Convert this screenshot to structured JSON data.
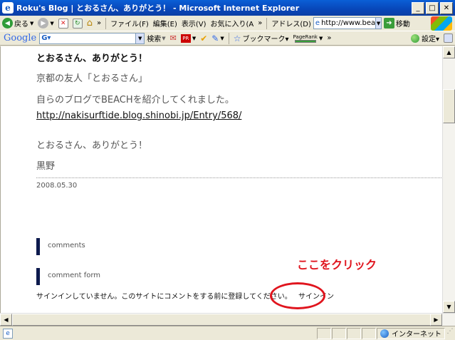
{
  "window": {
    "title": "Roku's Blog | とおるさん、ありがとう！ - Microsoft Internet Explorer",
    "icon": "ie-icon",
    "controls": [
      "minimize-icon",
      "maximize-icon",
      "close-icon"
    ]
  },
  "toolbar1": {
    "back_label": "戻る",
    "menu": [
      "ファイル(F)",
      "編集(E)",
      "表示(V)",
      "お気に入り(A"
    ],
    "more": "»",
    "address_label": "アドレス(D)",
    "address_value": "http://www.bea",
    "go_label": "移動"
  },
  "toolbar2": {
    "google": "Google",
    "search_value": "G▾",
    "search_label": "検索",
    "bookmarks_label": "ブックマーク▾",
    "pagerank_label": "PageRank",
    "more": "»",
    "settings_label": "設定▾"
  },
  "post": {
    "title": "とおるさん、ありがとう！",
    "lines": [
      "京都の友人「とおるさん」",
      "自らのブログでBEACHを紹介してくれました。"
    ],
    "link": "http://nakisurftide.blog.shinobi.jp/Entry/568/",
    "thanks": "とおるさん、ありがとう！",
    "author": "黒野",
    "date": "2008.05.30"
  },
  "comments": {
    "comments_label": "comments",
    "comment_form_label": "comment form",
    "notice": "サインインしていません。このサイトにコメントをする前に登録してください。",
    "signin_link": "サインイン"
  },
  "annotation": {
    "text": "ここをクリック",
    "color": "#e0151e"
  },
  "statusbar": {
    "zone": "インターネット"
  }
}
